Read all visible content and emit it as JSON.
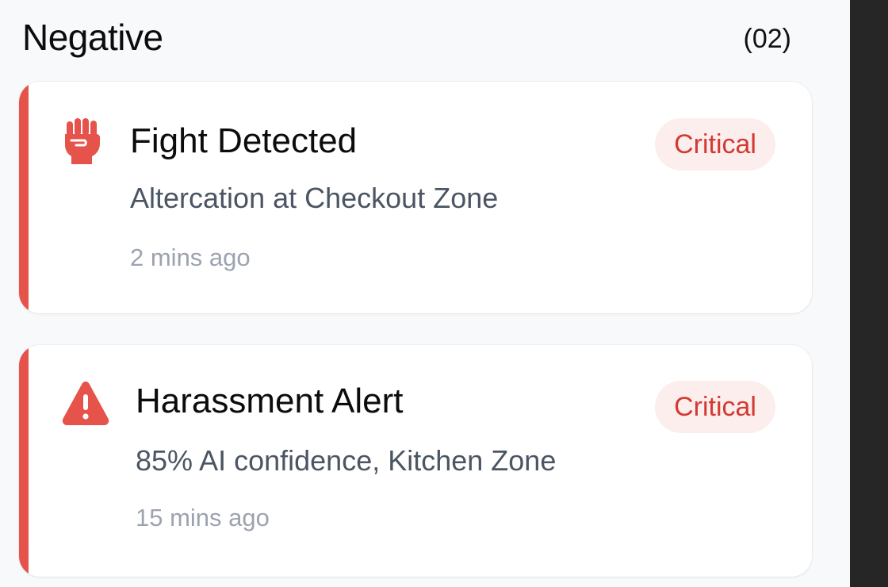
{
  "section": {
    "title": "Negative",
    "count": "(02)"
  },
  "colors": {
    "accent": "#e5534b",
    "badge_bg": "#fdeeee",
    "badge_text": "#d33a33"
  },
  "alerts": [
    {
      "icon": "fist-icon",
      "title": "Fight Detected",
      "description": "Altercation at Checkout Zone",
      "time": "2 mins ago",
      "severity": "Critical"
    },
    {
      "icon": "warning-triangle-icon",
      "title": "Harassment Alert",
      "description": "85% AI confidence, Kitchen Zone",
      "time": "15 mins ago",
      "severity": "Critical"
    }
  ]
}
